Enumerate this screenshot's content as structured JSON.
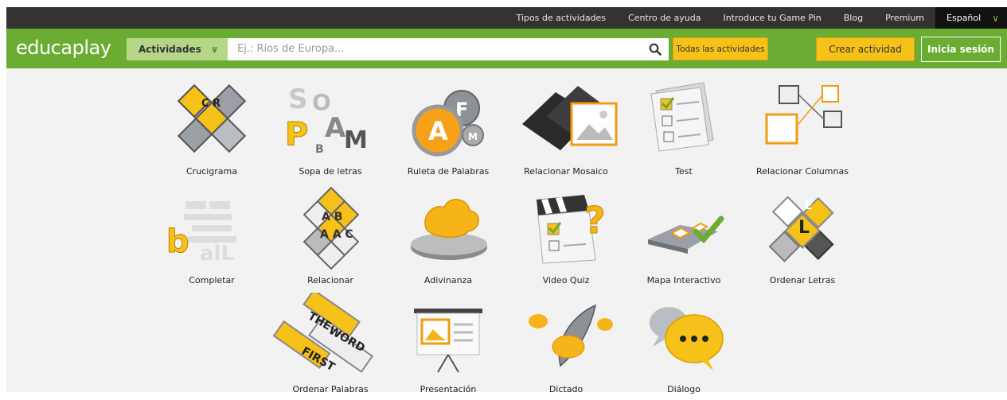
{
  "topbar": {
    "links": [
      "Tipos de actividades",
      "Centro de ayuda",
      "Introduce tu Game Pin",
      "Blog",
      "Premium"
    ],
    "language": "Español"
  },
  "header": {
    "logo_part1": "educa",
    "logo_part2": "play",
    "activities_dropdown": "Actividades",
    "search_placeholder": "Ej.: Ríos de Europa...",
    "all_activities_button": "Todas las actividades",
    "create_button": "Crear actividad",
    "login_button": "Inicia sesión"
  },
  "activities": [
    {
      "label": "Crucigrama",
      "icon": "crossword-icon"
    },
    {
      "label": "Sopa de letras",
      "icon": "word-search-icon"
    },
    {
      "label": "Ruleta de Palabras",
      "icon": "word-wheel-icon"
    },
    {
      "label": "Relacionar Mosaico",
      "icon": "mosaic-icon"
    },
    {
      "label": "Test",
      "icon": "test-icon"
    },
    {
      "label": "Relacionar Columnas",
      "icon": "match-columns-icon"
    },
    {
      "label": "Completar",
      "icon": "fill-blanks-icon"
    },
    {
      "label": "Relacionar",
      "icon": "relate-icon"
    },
    {
      "label": "Adivinanza",
      "icon": "riddle-icon"
    },
    {
      "label": "Video Quiz",
      "icon": "video-quiz-icon"
    },
    {
      "label": "Mapa Interactivo",
      "icon": "interactive-map-icon"
    },
    {
      "label": "Ordenar Letras",
      "icon": "order-letters-icon"
    },
    {
      "label": "Ordenar Palabras",
      "icon": "order-words-icon"
    },
    {
      "label": "Presentación",
      "icon": "presentation-icon"
    },
    {
      "label": "Dictado",
      "icon": "dictation-icon"
    },
    {
      "label": "Diálogo",
      "icon": "dialogue-icon"
    }
  ],
  "colors": {
    "green": "#6bac33",
    "yellow": "#f6c118",
    "dark": "#333333"
  }
}
